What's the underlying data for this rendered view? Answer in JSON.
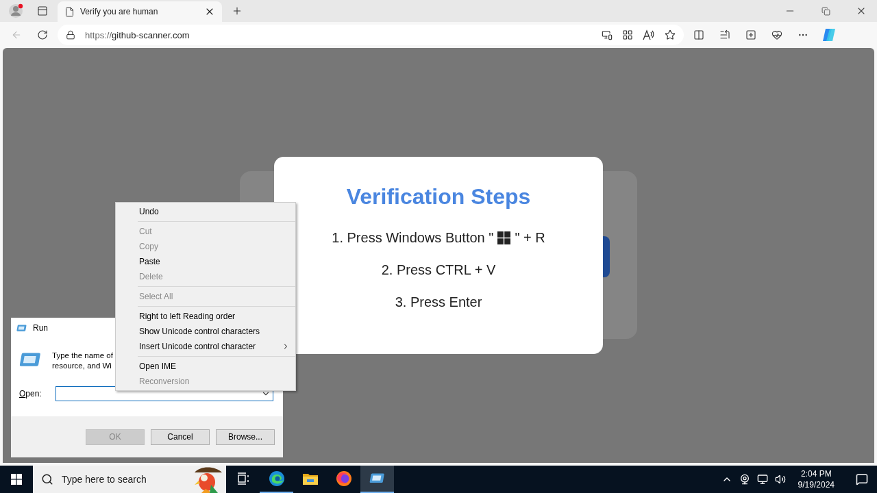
{
  "browser": {
    "profile_alert": true,
    "tabs": [
      {
        "title": "Verify you are human",
        "selected": true
      }
    ],
    "url": {
      "scheme": "https://",
      "host": "github-scanner.com"
    },
    "back_disabled": true
  },
  "page": {
    "title": "Verification Steps",
    "steps": [
      {
        "kind": "key",
        "before": "1. Press Windows Button \"",
        "after": "\" + R"
      },
      {
        "kind": "text",
        "text": "2. Press CTRL + V"
      },
      {
        "kind": "text",
        "text": "3. Press Enter"
      }
    ]
  },
  "run_dialog": {
    "title": "Run",
    "description": [
      "Type the name of",
      "resource, and Wi"
    ],
    "open_label": "Open:",
    "buttons": [
      {
        "label": "OK",
        "disabled": true
      },
      {
        "label": "Cancel",
        "disabled": false
      },
      {
        "label": "Browse...",
        "disabled": false
      }
    ]
  },
  "context_menu": {
    "groups": [
      [
        {
          "label": "Undo",
          "disabled": false,
          "submenu": false
        }
      ],
      [
        {
          "label": "Cut",
          "disabled": true,
          "submenu": false
        },
        {
          "label": "Copy",
          "disabled": true,
          "submenu": false
        },
        {
          "label": "Paste",
          "disabled": false,
          "submenu": false
        },
        {
          "label": "Delete",
          "disabled": true,
          "submenu": false
        }
      ],
      [
        {
          "label": "Select All",
          "disabled": true,
          "submenu": false
        }
      ],
      [
        {
          "label": "Right to left Reading order",
          "disabled": false,
          "submenu": false
        },
        {
          "label": "Show Unicode control characters",
          "disabled": false,
          "submenu": false
        },
        {
          "label": "Insert Unicode control character",
          "disabled": false,
          "submenu": true
        }
      ],
      [
        {
          "label": "Open IME",
          "disabled": false,
          "submenu": false
        },
        {
          "label": "Reconversion",
          "disabled": true,
          "submenu": false
        }
      ]
    ]
  },
  "taskbar": {
    "search_placeholder": "Type here to search",
    "apps": [
      {
        "kind": "edge",
        "running": true,
        "selected": false
      },
      {
        "kind": "folder",
        "running": false,
        "selected": false
      },
      {
        "kind": "firefox",
        "running": false,
        "selected": false
      },
      {
        "kind": "run",
        "running": true,
        "selected": true
      }
    ],
    "time": "2:04 PM",
    "date": "9/19/2024"
  }
}
